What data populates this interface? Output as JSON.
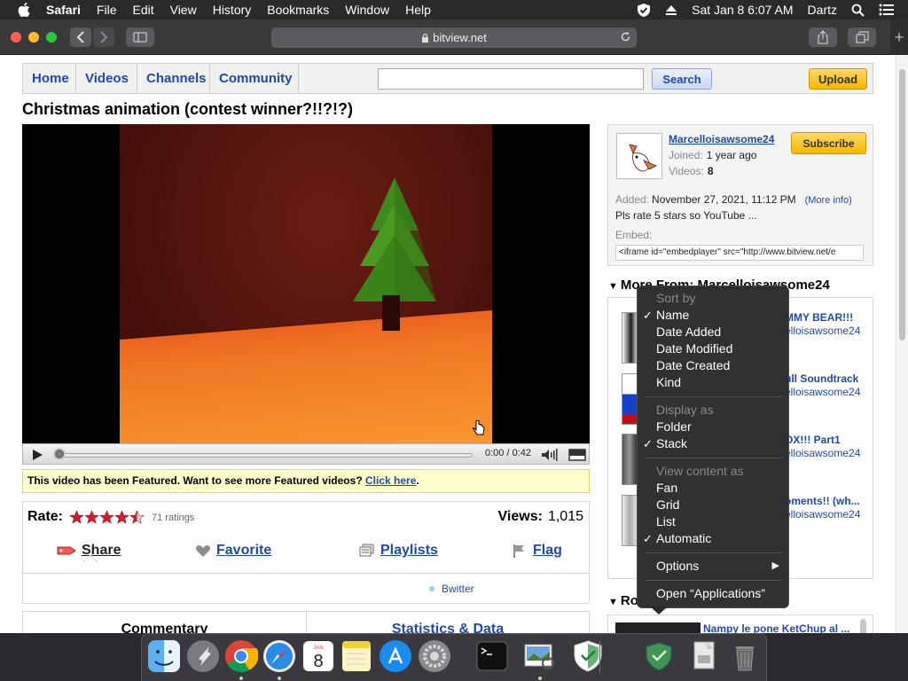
{
  "menubar": {
    "app_name": "Safari",
    "items": [
      "File",
      "Edit",
      "View",
      "History",
      "Bookmarks",
      "Window",
      "Help"
    ],
    "clock": "Sat Jan 8  6:07 AM",
    "user": "Dartz"
  },
  "browser": {
    "url": "bitview.net"
  },
  "site": {
    "nav": [
      "Home",
      "Videos",
      "Channels",
      "Community"
    ],
    "search_button": "Search",
    "search_value": "",
    "upload_button": "Upload"
  },
  "video": {
    "title": "Christmas animation (contest winner?!!?!?)",
    "time": "0:00 / 0:42",
    "featured_text": "This video has been Featured. Want to see more Featured videos?",
    "featured_link": "Click here",
    "featured_end": ".",
    "rate_label": "Rate:",
    "ratings": "71 ratings",
    "views_label": "Views:",
    "views": "1,015",
    "rating_stars": 4.5,
    "actions": {
      "share": "Share",
      "favorite": "Favorite",
      "playlists": "Playlists",
      "flag": "Flag"
    },
    "bwitter": "Bwitter",
    "tab_commentary": "Commentary",
    "tab_stats": "Statistics & Data"
  },
  "channel": {
    "name": "Marcelloisawsome24",
    "joined_label": "Joined:",
    "joined": "1 year ago",
    "videos_label": "Videos:",
    "videos": "8",
    "subscribe": "Subscribe",
    "added_label": "Added:",
    "added": "November 27, 2021, 11:12 PM",
    "more_info": "(More info)",
    "description": "Pls rate 5 stars so YouTube ...",
    "embed_label": "Embed:",
    "embed_code": "<iframe id=\"embedplayer\" src=\"http://www.bitview.net/e"
  },
  "more_from": {
    "header": "More From: Marcelloisawsome24",
    "videos": [
      {
        "title": "MMY BEAR!!!",
        "user": "elloisawsome24"
      },
      {
        "title": "ull Soundtrack",
        "user": "elloisawsome24"
      },
      {
        "title": "OX!!! Part1",
        "user": "elloisawsome24"
      },
      {
        "title": "oments!! (wh...",
        "user": "elloisawsome24"
      }
    ]
  },
  "related": {
    "header": "Ro",
    "first_title": "Nampy le pone KetChup al ..."
  },
  "context_menu": {
    "sort_by": "Sort by",
    "sort_options": [
      "Name",
      "Date Added",
      "Date Modified",
      "Date Created",
      "Kind"
    ],
    "display_as": "Display as",
    "display_options": [
      "Folder",
      "Stack"
    ],
    "view_content_as": "View content as",
    "view_options": [
      "Fan",
      "Grid",
      "List",
      "Automatic"
    ],
    "options": "Options",
    "open": "Open “Applications”",
    "checked": [
      "Name",
      "Stack",
      "Automatic"
    ]
  },
  "dock": {
    "calendar_month": "JAN",
    "calendar_day": "8"
  },
  "colors": {
    "link": "#2149a8",
    "featured_bg": "#ffffcc",
    "button_yellow": "#f5b800",
    "star_red": "#d0202f"
  }
}
